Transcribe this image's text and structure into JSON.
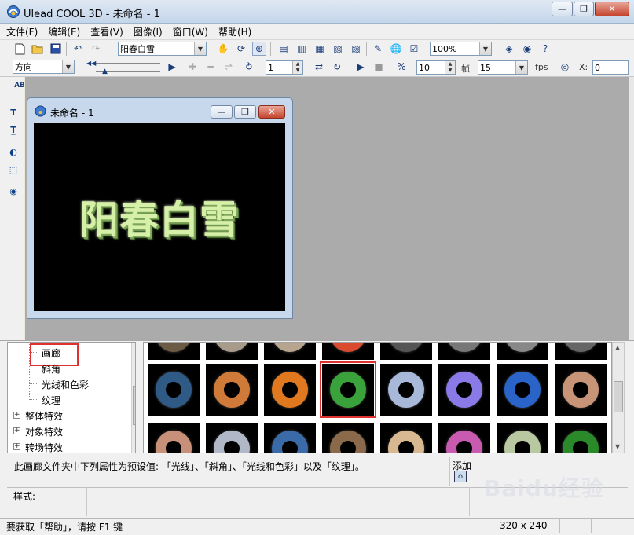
{
  "app": {
    "title": "Ulead COOL 3D - 未命名 - 1",
    "window_controls": [
      "—",
      "❐",
      "✕"
    ]
  },
  "menu": [
    "文件(F)",
    "编辑(E)",
    "查看(V)",
    "图像(I)",
    "窗口(W)",
    "帮助(H)"
  ],
  "toolbar1": {
    "text_combo": "阳春白雪",
    "zoom_combo": "100%"
  },
  "toolbar2": {
    "direction_combo": "方向",
    "frame_value": "1",
    "speed_value": "10",
    "frame_label": "帧",
    "fps_value": "15",
    "fps_label": "fps",
    "x_label": "X:",
    "x_value": "0"
  },
  "document": {
    "title": "未命名 - 1",
    "canvas_text": "阳春白雪"
  },
  "tree": {
    "items": [
      {
        "label": "画廊",
        "highlighted": true
      },
      {
        "label": "斜角"
      },
      {
        "label": "光线和色彩"
      },
      {
        "label": "纹理"
      },
      {
        "label": "整体特效",
        "expander": "+"
      },
      {
        "label": "对象特效",
        "expander": "+"
      },
      {
        "label": "转场特效",
        "expander": "+"
      }
    ]
  },
  "gallery": {
    "selected_index": 3,
    "row_top_colors": [
      "#6b5a44",
      "#a89b8a",
      "#b8a58f",
      "#d94a2f",
      "#555",
      "#777",
      "#888",
      "#666"
    ],
    "row_mid_colors": [
      "#2f5a86",
      "#d07a3a",
      "#e07820",
      "#3aa23a",
      "#a8b8d8",
      "#8a7ae8",
      "#2a64c8",
      "#c89478"
    ],
    "row_bottom_colors": [
      "#c89078",
      "#b0b8c8",
      "#3a6aa8",
      "#8a6a4a",
      "#d8b890",
      "#c85ab0",
      "#b8c8a0",
      "#2a8a2a"
    ]
  },
  "description": "此画廊文件夹中下列属性为预设值: 「光线」、「斜角」、「光线和色彩」以及「纹理」。",
  "add": {
    "label": "添加"
  },
  "style": {
    "label": "样式:"
  },
  "status": {
    "help_text": "要获取「帮助」，请按 F1 键",
    "size_text": "320 x 240"
  },
  "watermark": {
    "text": "Baidu经验"
  },
  "colors": {
    "title_bar": "#c4d6ea",
    "workspace": "#ababab",
    "highlight_box": "#e03030"
  }
}
